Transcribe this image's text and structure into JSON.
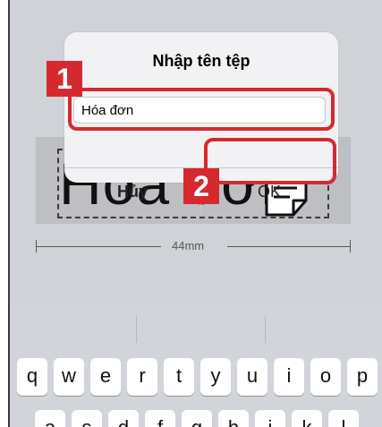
{
  "dialog": {
    "title": "Nhập tên tệp",
    "field_value": "Hóa đơn",
    "cancel_label": "Hủy",
    "ok_label": "OK"
  },
  "background": {
    "label_text": "Hóa đơn",
    "width_label": "44mm"
  },
  "annotations": {
    "step1": "1",
    "step2": "2"
  },
  "keyboard": {
    "row1": [
      "q",
      "w",
      "e",
      "r",
      "t",
      "y",
      "u",
      "i",
      "o",
      "p"
    ],
    "row2": [
      "a",
      "s",
      "d",
      "f",
      "g",
      "h",
      "j",
      "k",
      "l"
    ]
  },
  "colors": {
    "highlight": "#d6292f",
    "dialog_bg": "#f2f2f4",
    "screen_dim": "#cfd2d6"
  }
}
